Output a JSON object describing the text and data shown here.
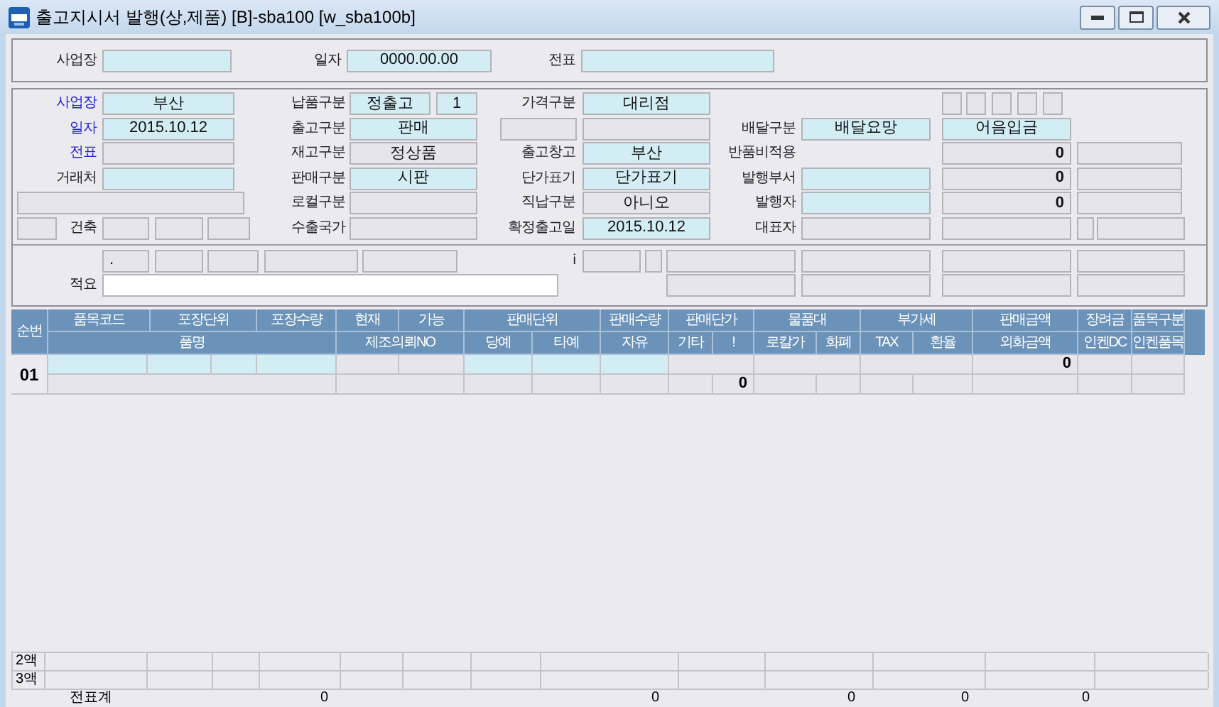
{
  "window": {
    "title": "출고지시서 발행(상,제품) [B]-sba100 [w_sba100b]"
  },
  "header_panel": {
    "cells": [
      {
        "label": {
          "text": "사업장",
          "required": false
        },
        "fields": [
          {
            "kind": "field",
            "highlighted": true
          }
        ]
      },
      {
        "label": {
          "text": "일자",
          "required": false
        },
        "fields": [
          {
            "kind": "field",
            "value": "0000.00.00",
            "highlighted": true
          }
        ]
      },
      {
        "label": {
          "text": "전표",
          "required": false
        },
        "fields": [
          {
            "kind": "field",
            "highlighted": true
          }
        ]
      }
    ]
  },
  "form_panel": {
    "rows": [
      [
        {
          "label": {
            "text": "사업장",
            "required": true
          },
          "fields": [
            {
              "kind": "field",
              "value": "부산",
              "highlighted": true
            }
          ]
        },
        {
          "label": {
            "text": "납품구분",
            "required": false
          },
          "fields": [
            {
              "kind": "field",
              "value": "정출고",
              "highlighted": true
            },
            {
              "kind": "field",
              "value": "1",
              "highlighted": true
            }
          ]
        },
        {
          "label": {
            "text": "가격구분",
            "required": false
          },
          "fields": [
            {
              "kind": "field",
              "value": "대리점",
              "highlighted": true
            }
          ]
        },
        {},
        {
          "fields": [
            {
              "kind": "field",
              "highlighted": false
            },
            {
              "kind": "field",
              "highlighted": false
            },
            {
              "kind": "field",
              "highlighted": false
            },
            {
              "kind": "field",
              "highlighted": false
            },
            {
              "kind": "field",
              "highlighted": false
            }
          ]
        },
        {}
      ],
      [
        {
          "label": {
            "text": "일자",
            "required": true
          },
          "fields": [
            {
              "kind": "field",
              "value": "2015.10.12",
              "highlighted": true
            }
          ]
        },
        {
          "label": {
            "text": "출고구분",
            "required": false
          },
          "fields": [
            {
              "kind": "field",
              "value": "판매",
              "highlighted": true
            }
          ]
        },
        {
          "fields": [
            {
              "kind": "field",
              "highlighted": false
            },
            {
              "kind": "field",
              "highlighted": false
            }
          ]
        },
        {
          "label": {
            "text": "배달구분",
            "required": false
          },
          "fields": [
            {
              "kind": "field",
              "value": "배달요망",
              "highlighted": true
            }
          ]
        },
        {
          "fields": [
            {
              "kind": "field",
              "value": "어음입금",
              "highlighted": true
            }
          ]
        },
        {}
      ],
      [
        {
          "label": {
            "text": "전표",
            "required": true
          },
          "fields": [
            {
              "kind": "field",
              "highlighted": false
            }
          ]
        },
        {
          "label": {
            "text": "재고구분",
            "required": false
          },
          "fields": [
            {
              "kind": "field",
              "value": "정상품",
              "highlighted": false
            }
          ]
        },
        {
          "label": {
            "text": "출고창고",
            "required": false
          },
          "fields": [
            {
              "kind": "field",
              "value": "부산",
              "highlighted": true
            }
          ]
        },
        {
          "label": {
            "text": "반품비적용",
            "required": false
          }
        },
        {
          "fields": [
            {
              "kind": "amount",
              "value": "0",
              "highlighted": false
            }
          ]
        },
        {
          "fields": [
            {
              "kind": "field",
              "highlighted": false
            }
          ]
        }
      ],
      [
        {
          "label": {
            "text": "거래처",
            "required": false
          },
          "fields": [
            {
              "kind": "field",
              "highlighted": true
            }
          ]
        },
        {
          "label": {
            "text": "판매구분",
            "required": false
          },
          "fields": [
            {
              "kind": "field",
              "value": "시판",
              "highlighted": true
            }
          ]
        },
        {
          "label": {
            "text": "단가표기",
            "required": false
          },
          "fields": [
            {
              "kind": "field",
              "value": "단가표기",
              "highlighted": true
            }
          ]
        },
        {
          "label": {
            "text": "발행부서",
            "required": false
          },
          "fields": [
            {
              "kind": "field",
              "highlighted": true
            }
          ]
        },
        {
          "fields": [
            {
              "kind": "amount",
              "value": "0",
              "highlighted": false
            }
          ]
        },
        {
          "fields": [
            {
              "kind": "field",
              "highlighted": false
            }
          ]
        }
      ],
      [
        {
          "fields": [
            {
              "kind": "field",
              "highlighted": false
            }
          ]
        },
        {
          "label": {
            "text": "로컬구분",
            "required": false
          },
          "fields": [
            {
              "kind": "field",
              "highlighted": false
            }
          ]
        },
        {
          "label": {
            "text": "직납구분",
            "required": false
          },
          "fields": [
            {
              "kind": "field",
              "value": "아니오",
              "highlighted": false
            }
          ]
        },
        {
          "label": {
            "text": "발행자",
            "required": false
          },
          "fields": [
            {
              "kind": "field",
              "highlighted": true
            }
          ]
        },
        {
          "fields": [
            {
              "kind": "amount",
              "value": "0",
              "highlighted": false
            }
          ]
        },
        {
          "fields": [
            {
              "kind": "field",
              "highlighted": false
            }
          ]
        }
      ],
      [
        {
          "label": {
            "text": "건축",
            "required": false
          },
          "fields": [
            {
              "kind": "field",
              "highlighted": false
            },
            {
              "kind": "field",
              "highlighted": false
            },
            {
              "kind": "field",
              "highlighted": false
            },
            {
              "kind": "field",
              "highlighted": false
            }
          ]
        },
        {
          "label": {
            "text": "수출국가",
            "required": false
          },
          "fields": [
            {
              "kind": "field",
              "highlighted": false
            }
          ]
        },
        {
          "label": {
            "text": "확정출고일",
            "required": false
          },
          "fields": [
            {
              "kind": "field",
              "value": "2015.10.12",
              "highlighted": true
            }
          ]
        },
        {
          "label": {
            "text": "대표자",
            "required": false
          },
          "fields": [
            {
              "kind": "field",
              "highlighted": false
            }
          ]
        },
        {
          "fields": [
            {
              "kind": "field",
              "highlighted": false
            }
          ]
        },
        {
          "fields": [
            {
              "kind": "field",
              "highlighted": false
            },
            {
              "kind": "field",
              "highlighted": false
            }
          ]
        }
      ]
    ]
  },
  "memo_panel": {
    "rows": [
      [
        {
          "fields": [
            {
              "kind": "text",
              "value": ".",
              "highlighted": false
            },
            {
              "kind": "field",
              "highlighted": false
            },
            {
              "kind": "field",
              "highlighted": false
            },
            {
              "kind": "field",
              "highlighted": false
            },
            {
              "kind": "field",
              "highlighted": false
            }
          ]
        },
        {
          "label": {
            "text": "i",
            "required": false
          },
          "fields": [
            {
              "kind": "field",
              "highlighted": false
            },
            {
              "kind": "field",
              "highlighted": false
            }
          ]
        },
        {
          "fields": [
            {
              "kind": "field",
              "highlighted": false
            }
          ]
        },
        {
          "fields": [
            {
              "kind": "field",
              "highlighted": false
            }
          ]
        },
        {
          "fields": [
            {
              "kind": "field",
              "highlighted": false
            }
          ]
        },
        {
          "fields": [
            {
              "kind": "field",
              "highlighted": false
            }
          ]
        }
      ],
      [
        {
          "label": {
            "text": "적요",
            "required": false
          },
          "fields": [
            {
              "kind": "memo"
            }
          ]
        },
        {},
        {
          "fields": [
            {
              "kind": "field",
              "highlighted": false
            }
          ]
        },
        {
          "fields": [
            {
              "kind": "field",
              "highlighted": false
            }
          ]
        },
        {
          "fields": [
            {
              "kind": "field",
              "highlighted": false
            }
          ]
        },
        {
          "fields": [
            {
              "kind": "field",
              "highlighted": false
            }
          ]
        }
      ]
    ]
  },
  "table": {
    "number_header": "순번",
    "header_top": [
      "품목코드",
      "포장단위",
      "포장수량",
      "현재",
      "가능",
      "판매단위",
      "판매수량",
      "판매단가",
      "물품대",
      "부가세",
      "판매금액",
      "장려금",
      "품목구분"
    ],
    "header_bottom": [
      "품명",
      "제조의뢰NO",
      "당예",
      "타예",
      "자유",
      "기타",
      "!",
      "로칼가",
      "화폐",
      "TAX",
      "환율",
      "외화금액",
      "인켄DC",
      "인켄품목"
    ],
    "rows": [
      {
        "number": "01",
        "top_cells": [
          {
            "highlighted": true
          },
          {
            "highlighted": true
          },
          {
            "highlighted": true
          },
          {
            "highlighted": true
          },
          {
            "highlighted": false
          },
          {
            "highlighted": false
          },
          {
            "highlighted": true
          },
          {
            "highlighted": true
          },
          {
            "highlighted": true
          },
          {
            "highlighted": false
          },
          {
            "highlighted": false
          },
          {
            "highlighted": false
          },
          {
            "value": "0",
            "highlighted": false
          },
          {
            "highlighted": false
          },
          {
            "highlighted": false
          }
        ],
        "bottom_cells": [
          {},
          {},
          {},
          {},
          {},
          {},
          {
            "value": "0"
          },
          {},
          {},
          {},
          {},
          {},
          {},
          {}
        ]
      }
    ]
  },
  "totals": {
    "rows": [
      {
        "label": "2액"
      },
      {
        "label": "3액"
      }
    ],
    "grand_total": {
      "label": "전표계",
      "values": [
        "0",
        "0",
        "0",
        "0",
        "0"
      ]
    }
  }
}
